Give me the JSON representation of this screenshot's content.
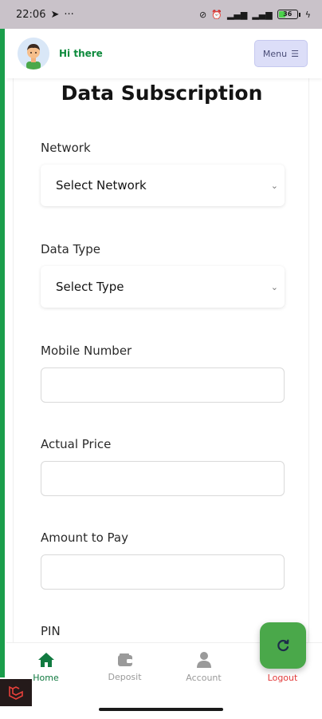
{
  "status_bar": {
    "time": "22:06",
    "battery": "36"
  },
  "header": {
    "greeting": "Hi there",
    "menu_label": "Menu"
  },
  "form": {
    "title": "Data Subscription",
    "network_label": "Network",
    "network_value": "Select Network",
    "data_type_label": "Data Type",
    "data_type_value": "Select Type",
    "mobile_label": "Mobile Number",
    "actual_price_label": "Actual Price",
    "amount_label": "Amount to Pay",
    "pin_label": "PIN"
  },
  "bottom_nav": {
    "items": [
      {
        "label": "Home",
        "icon": "home-icon"
      },
      {
        "label": "Deposit",
        "icon": "wallet-icon"
      },
      {
        "label": "Account",
        "icon": "user-icon"
      },
      {
        "label": "Logout",
        "icon": "logout-icon"
      }
    ]
  },
  "colors": {
    "accent_green": "#117a40",
    "fab_green": "#4aa84a",
    "logout_red": "#e23b3b",
    "menu_bg": "#dcdef8"
  }
}
